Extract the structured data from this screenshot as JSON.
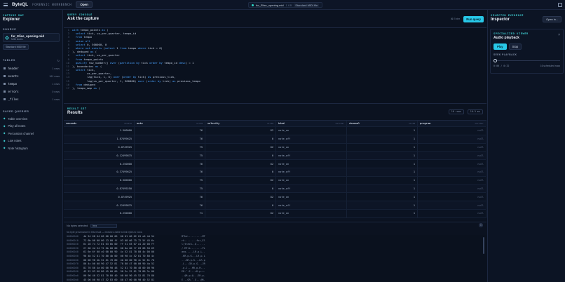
{
  "app": {
    "name": "ByteQL",
    "subtitle": "FORENSIC WORKBENCH",
    "open_label": "Open"
  },
  "file_pill": {
    "name": "fur_Elise_opening.mid",
    "size": "1 KB",
    "format": "Standard MIDI file"
  },
  "explorer": {
    "kicker": "CAPTURE MAP",
    "title": "Explorer",
    "source_head": "SOURCE",
    "source": {
      "name": "fur_Elise_opening.mid",
      "meta": "MIDI Audio"
    },
    "source_btn": "Standard MIDI file",
    "tables_head": "TABLES",
    "tables": [
      {
        "name": "header",
        "count": "1 rows"
      },
      {
        "name": "events",
        "count": "161 rows"
      },
      {
        "name": "tempo",
        "count": "1 rows"
      },
      {
        "name": "errors",
        "count": "0 rows"
      },
      {
        "name": "_files",
        "count": "1 rows"
      }
    ],
    "saved_head": "SAVED QUERIES",
    "saved": [
      "Table overview",
      "Play all notes",
      "Percussion channel",
      "Low notes",
      "Note histogram"
    ]
  },
  "console": {
    "kicker": "QUERY CONSOLE",
    "title": "Ask the capture",
    "hint": "⌘ Enter",
    "run_label": "Run query",
    "code": [
      "with tempo_points as (",
      "  select tick, us_per_quarter, tempo_id",
      "  from tempo",
      "  union all",
      "  select 0, 500000, 0",
      "  where not exists (select 1 from tempo where tick = 0)",
      "), deduped as (",
      "  select tick, us_per_quarter",
      "  from tempo_points",
      "  qualify row_number() over (partition by tick order by tempo_id desc) = 1",
      "), boundaries as (",
      "  select tick,",
      "         us_per_quarter,",
      "         lag(tick, 1, 0) over (order by tick) as previous_tick,",
      "         lag(us_per_quarter, 1, 500000) over (order by tick) as previous_tempo",
      "  from deduped",
      "), tempo_map as ("
    ]
  },
  "results": {
    "kicker": "RESULT SET",
    "title": "Results",
    "rows_chip": "16 rows",
    "time_chip": "10.5 ms",
    "columns": [
      {
        "name": "seconds",
        "type": "double"
      },
      {
        "name": "note",
        "type": "uint8"
      },
      {
        "name": "velocity",
        "type": "uint8"
      },
      {
        "name": "kind",
        "type": "varchar"
      },
      {
        "name": "channel",
        "type": "uint8"
      },
      {
        "name": "program",
        "type": "varchar"
      }
    ],
    "rows": [
      [
        "1.500000",
        "76",
        "82",
        "note_on",
        "1",
        "null"
      ],
      [
        "1.87499625",
        "76",
        "0",
        "note_off",
        "1",
        "null"
      ],
      [
        "0.8749925",
        "75",
        "82",
        "note_on",
        "1",
        "null"
      ],
      [
        "0.12499875",
        "75",
        "0",
        "note_off",
        "1",
        "null"
      ],
      [
        "0.250000",
        "76",
        "82",
        "note_on",
        "1",
        "null"
      ],
      [
        "0.37499625",
        "76",
        "0",
        "note_off",
        "1",
        "null"
      ],
      [
        "0.500000",
        "75",
        "82",
        "note_on",
        "1",
        "null"
      ],
      [
        "0.87499250",
        "75",
        "0",
        "note_off",
        "1",
        "null"
      ],
      [
        "0.8749925",
        "76",
        "82",
        "note_on",
        "1",
        "null"
      ],
      [
        "0.12499875",
        "76",
        "0",
        "note_off",
        "1",
        "null"
      ],
      [
        "0.250000",
        "71",
        "82",
        "note_on",
        "1",
        "null"
      ]
    ]
  },
  "bytes": {
    "label": "No bytes selected",
    "encoding": "hex",
    "note": "No byte provenance in this result — browse a table to link bytes to rows.",
    "rows": [
      {
        "off": "00000000",
        "hex": "4d 54 68 64 00 00 00 06  00 01 00 02 01 e0 4d 54",
        "ascii": "MThd..........MT"
      },
      {
        "off": "00000010",
        "hex": "72 6b 00 00 00 13 00 ff  03 08 66 75 72 5f 45 6c",
        "ascii": "rk........fur_El"
      },
      {
        "off": "00000020",
        "hex": "6c 28 74 72 61 63 6b 00  ff 51 03 07 a1 20 00 ff",
        "ascii": "l(track..Q... .."
      },
      {
        "off": "00000030",
        "hex": "2f 00 4d 54 72 6b 00 00  00 8a 00 ff 03 08 50 69",
        "ascii": "/.MTrk........Pi"
      },
      {
        "off": "00000040",
        "hex": "61 6e 6f 00 c0 00 00 90  4c 52 81 70 80 4c 00 00",
        "ascii": "ano.....LR.p.L.."
      },
      {
        "off": "00000050",
        "hex": "90 4b 52 81 70 80 4b 00  00 90 4c 52 81 70 80 4c",
        "ascii": ".KR.p.K...LR.p.L"
      },
      {
        "off": "00000060",
        "hex": "00 00 90 4b 52 81 70 80  4b 00 00 90 4c 52 81 70",
        "ascii": "...KR.p.K...LR.p"
      },
      {
        "off": "00000070",
        "hex": "80 4c 00 00 90 47 52 81  70 80 47 00 00 90 4a 52",
        "ascii": ".L...GR.p.G...JR"
      },
      {
        "off": "00000080",
        "hex": "81 70 80 4a 00 00 90 48  52 81 70 80 48 00 00 90",
        "ascii": ".p.J...HR.p.H..."
      },
      {
        "off": "00000090",
        "hex": "45 52 83 60 80 45 00 00  90 3c 52 81 70 80 3c 00",
        "ascii": "ER.`.E...<R.p.<."
      },
      {
        "off": "000000a0",
        "hex": "00 90 40 52 81 70 80 40  00 00 90 45 52 81 70 80",
        "ascii": "..@R.p.@...ER.p."
      },
      {
        "off": "000000b0",
        "hex": "45 00 00 90 47 52 83 60  80 47 00 00 90 40 52 81",
        "ascii": "E...GR.`.G...@R."
      }
    ]
  },
  "inspector": {
    "kicker": "SELECTED EVIDENCE",
    "title": "Inspector",
    "open_in": "Open in...",
    "viewer_kicker": "SPECIALIZED VIEWER",
    "viewer_title": "Audio playback",
    "play": "Play",
    "stop": "Stop",
    "seek_label": "SEEK PLAYBACK",
    "seek_fraction": 0,
    "time": "0:00 / 0:32",
    "scheduled": "16 scheduled rows"
  },
  "colors": {
    "accent": "#28c8e8",
    "kicker": "#3fd0d4",
    "background": "#0b1220"
  }
}
